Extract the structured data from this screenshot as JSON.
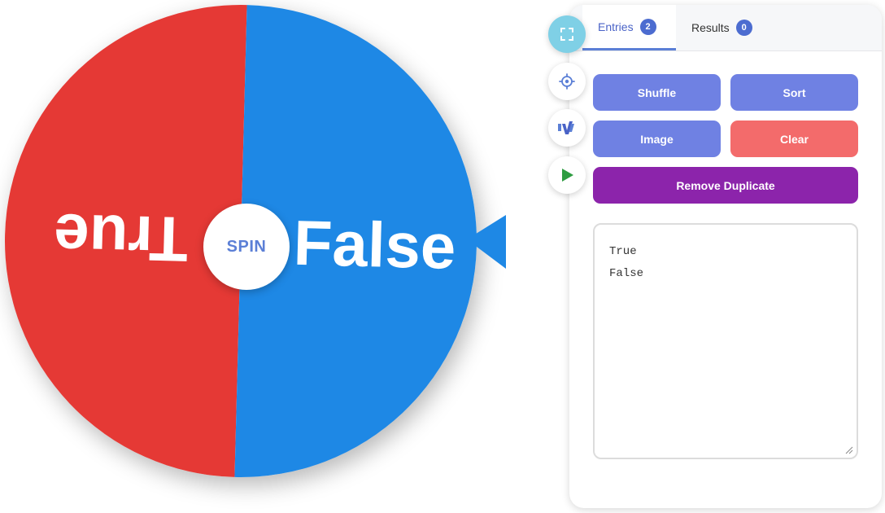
{
  "wheel": {
    "segments": [
      {
        "label": "True",
        "color": "#e53935"
      },
      {
        "label": "False",
        "color": "#1e88e5"
      }
    ],
    "spin_label": "SPIN",
    "pointer_color": "#1e88e5"
  },
  "tools": [
    {
      "name": "fullscreen-icon",
      "active": true
    },
    {
      "name": "settings-icon",
      "active": false
    },
    {
      "name": "brand-logo-icon",
      "active": false
    },
    {
      "name": "play-icon",
      "active": false
    }
  ],
  "tabs": [
    {
      "label": "Entries",
      "count": "2",
      "active": true
    },
    {
      "label": "Results",
      "count": "0",
      "active": false
    }
  ],
  "buttons": {
    "shuffle": "Shuffle",
    "sort": "Sort",
    "image": "Image",
    "clear": "Clear",
    "remove_duplicate": "Remove Duplicate"
  },
  "entries": {
    "lines": [
      "True",
      "False"
    ]
  },
  "colors": {
    "accent": "#5b7fd6",
    "button_blue": "#6f81e3",
    "button_red": "#f36b6b",
    "button_purple": "#8c24ab"
  }
}
